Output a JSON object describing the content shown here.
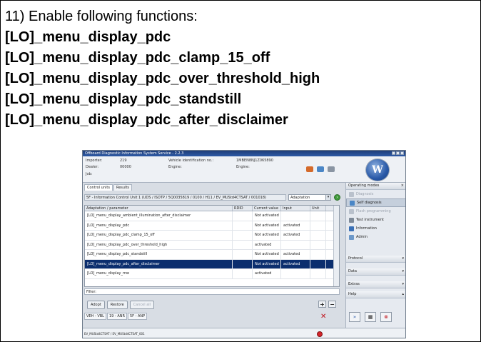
{
  "instructions": {
    "step": "11) Enable following functions:",
    "functions": [
      "[LO]_menu_display_pdc",
      "[LO]_menu_display_pdc_clamp_15_off",
      "[LO]_menu_display_pdc_over_threshold_high",
      "[LO]_menu_display_pdc_standstill",
      "[LO]_menu_display_pdc_after_disclaimer"
    ]
  },
  "app": {
    "title": "Offboard Diagnostic Information System Service - 2.2.3",
    "header": {
      "importer_label": "Importer:",
      "importer_value": "219",
      "dealer_label": "Dealer:",
      "dealer_value": "00000",
      "job_label": "Job:",
      "vin_label": "Vehicle identification no.:",
      "vin_value": "1MBEN8NJ1Z065890",
      "engine_label": "Engine:",
      "engine_value": "Engine:"
    },
    "tabs": [
      "Control units",
      "Results"
    ],
    "control_unit": "5F - Information Control Unit 1  (UDS / ISOTP / 5Q0035819  / 0100 / H11 / EV_MUStd4CTSAT / 001018)",
    "mode_select": "Adaptation",
    "table": {
      "columns": [
        "Adaptation / parameter",
        "RDID",
        "Current value",
        "Input",
        "Unit"
      ],
      "rows": [
        {
          "name": "[LO]_menu_display_ambient_illumination_after_disclaimer",
          "current": "Not activated",
          "input": ""
        },
        {
          "name": "[LO]_menu_display_pdc",
          "current": "Not activated",
          "input": "activated"
        },
        {
          "name": "[LO]_menu_display_pdc_clamp_15_off",
          "current": "Not activated",
          "input": "activated"
        },
        {
          "name": "[LO]_menu_display_pdc_over_threshold_high",
          "current": "activated",
          "input": ""
        },
        {
          "name": "[LO]_menu_display_pdc_standstill",
          "current": "Not activated",
          "input": "activated"
        },
        {
          "name": "[LO]_menu_display_pdc_after_disclaimer",
          "current": "Not activated",
          "input": "activated"
        },
        {
          "name": "[LO]_menu_display_mw",
          "current": "activated",
          "input": ""
        }
      ]
    },
    "filter_label": "Filter:",
    "buttons": {
      "adopt": "Adopt",
      "restore": "Restore",
      "cancel": "Cancel all"
    },
    "bottom_tabs": [
      "VEH - VBL",
      "19 - ANR",
      "5F - ANP"
    ],
    "status_text": "EV_MUStd4CTSAT / EV_MUStd4CTSAT_001",
    "right_panel": {
      "operating_modes": "Operating modes",
      "items": [
        "Diagnosis",
        "Self diagnosis",
        "Flash programming",
        "Test instrument",
        "Information",
        "Admin"
      ],
      "sections": [
        "Protocol",
        "Data",
        "Extras",
        "Help"
      ]
    },
    "colors": {
      "selection": "#0b2e6e",
      "titlebar": "#1f3e78",
      "stop": "#d4242a",
      "go": "#3f9a3a"
    }
  }
}
